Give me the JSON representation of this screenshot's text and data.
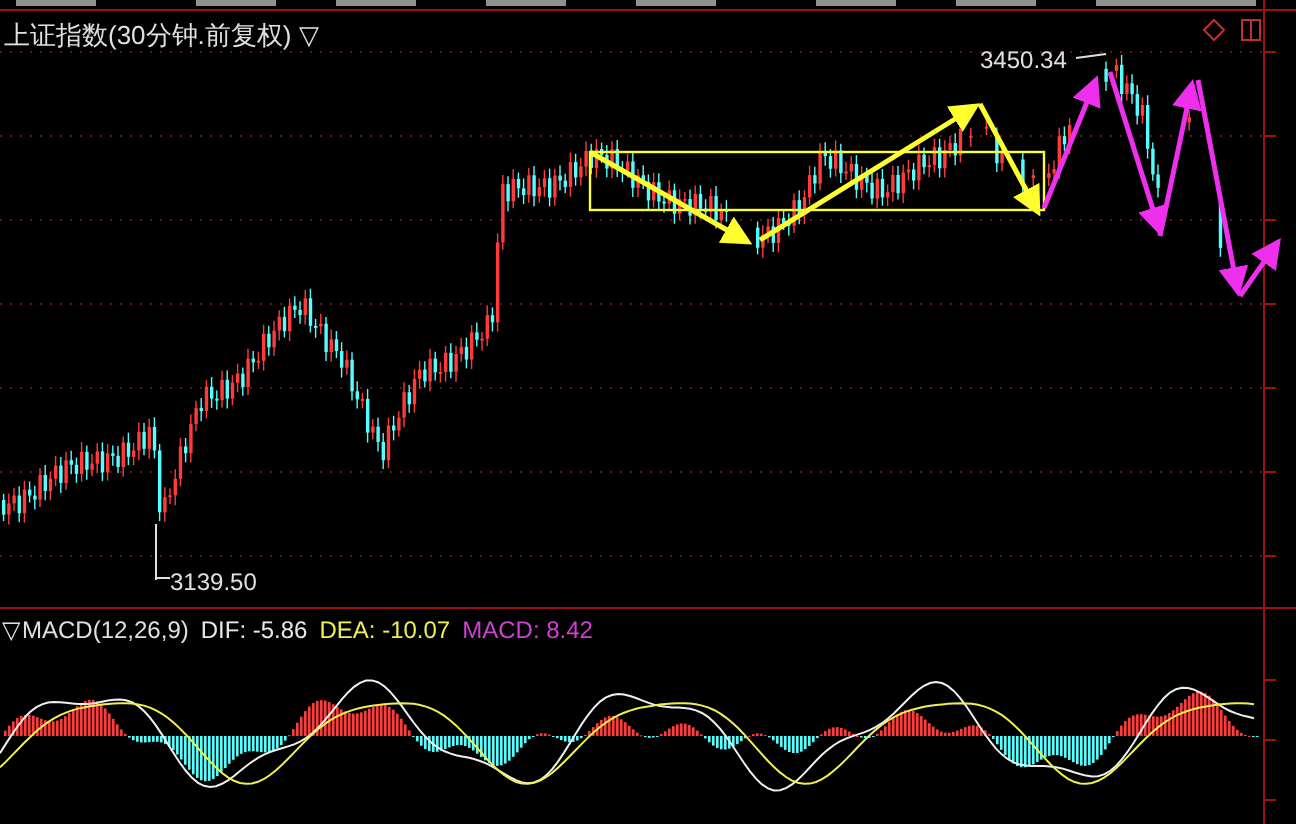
{
  "chart_title": {
    "text": "上证指数(30分钟.前复权)",
    "caret": "▽"
  },
  "price_labels": {
    "high": "3450.34",
    "low": "3139.50"
  },
  "macd_header": {
    "caret": "▽",
    "name": "MACD(12,26,9)",
    "dif": "DIF: -5.86",
    "dea": "DEA: -10.07",
    "macd": "MACD: 8.42"
  }
}
